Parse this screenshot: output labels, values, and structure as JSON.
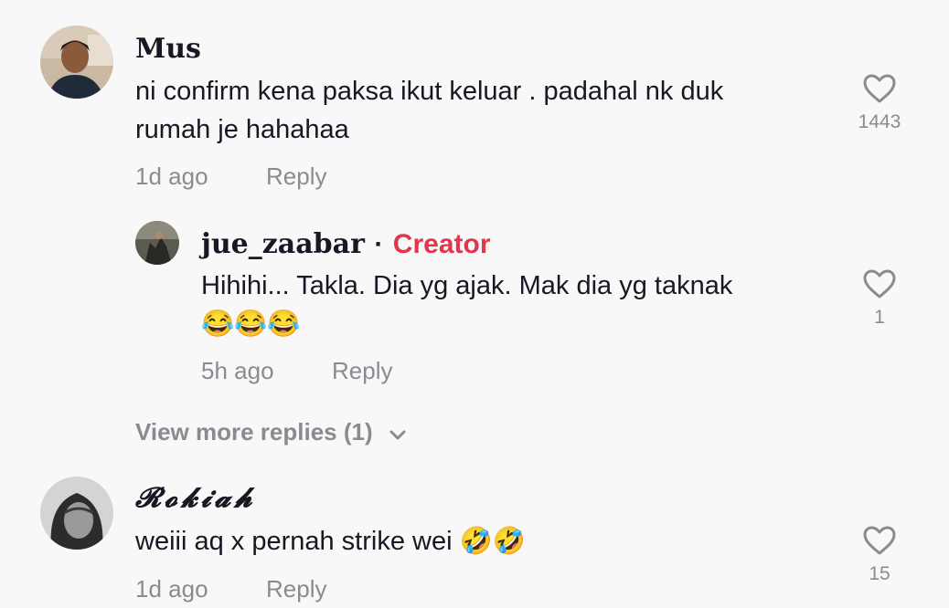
{
  "comments": [
    {
      "username": "Mus",
      "text_line1": "ni confirm kena paksa ikut keluar . padahal nk duk",
      "text_line2": "rumah je hahahaa",
      "time": "1d ago",
      "reply_label": "Reply",
      "likes": "1443",
      "reply": {
        "username": "jue_zaabar",
        "separator": "·",
        "badge": "Creator",
        "text_line1": "Hihihi... Takla. Dia yg ajak. Mak dia yg taknak",
        "text_line2": "😂😂😂",
        "time": "5h ago",
        "reply_label": "Reply",
        "likes": "1"
      },
      "view_more": "View more replies (1)"
    },
    {
      "username": "𝓡𝓸𝓴𝓲𝓪𝓱",
      "text_line1": "weiii aq x pernah strike wei 🤣🤣",
      "time": "1d ago",
      "reply_label": "Reply",
      "likes": "15"
    }
  ],
  "colors": {
    "creator": "#e0374f",
    "muted": "#8a8b91",
    "text": "#161823",
    "background": "#f8f8f8"
  },
  "icons": {
    "like": "heart-outline-icon",
    "expand": "chevron-down-icon"
  }
}
